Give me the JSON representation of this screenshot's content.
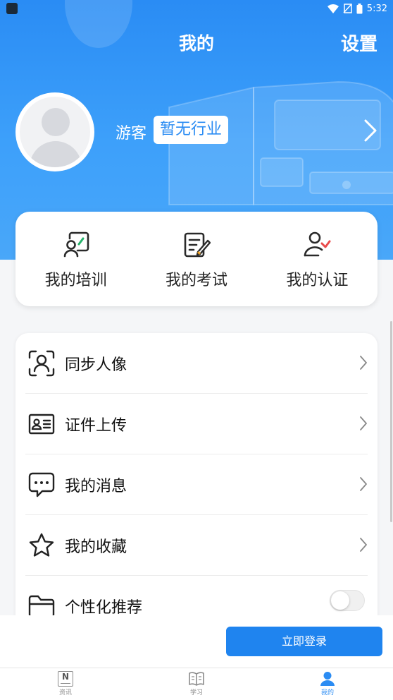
{
  "status_bar": {
    "time": "5:32"
  },
  "header": {
    "title": "我的",
    "settings_label": "设置"
  },
  "profile": {
    "username": "游客",
    "industry_badge": "暂无行业"
  },
  "quick_actions": [
    {
      "label": "我的培训",
      "icon": "training-icon"
    },
    {
      "label": "我的考试",
      "icon": "exam-icon"
    },
    {
      "label": "我的认证",
      "icon": "certification-icon"
    }
  ],
  "menu": [
    {
      "label": "同步人像",
      "icon": "face-scan-icon"
    },
    {
      "label": "证件上传",
      "icon": "id-card-icon"
    },
    {
      "label": "我的消息",
      "icon": "message-icon"
    },
    {
      "label": "我的收藏",
      "icon": "star-icon"
    },
    {
      "label": "个性化推荐",
      "icon": "folder-icon",
      "toggle": false
    }
  ],
  "login": {
    "label": "立即登录"
  },
  "tabs": [
    {
      "label": "资讯",
      "icon": "news-icon",
      "active": false
    },
    {
      "label": "学习",
      "icon": "book-icon",
      "active": false
    },
    {
      "label": "我的",
      "icon": "person-icon",
      "active": true
    }
  ],
  "colors": {
    "primary": "#2b8cf3",
    "header_gradient_top": "#2a8cf4",
    "login_button": "#1f84ef",
    "check_red": "#e94b4b",
    "pen_green": "#26b36b"
  }
}
